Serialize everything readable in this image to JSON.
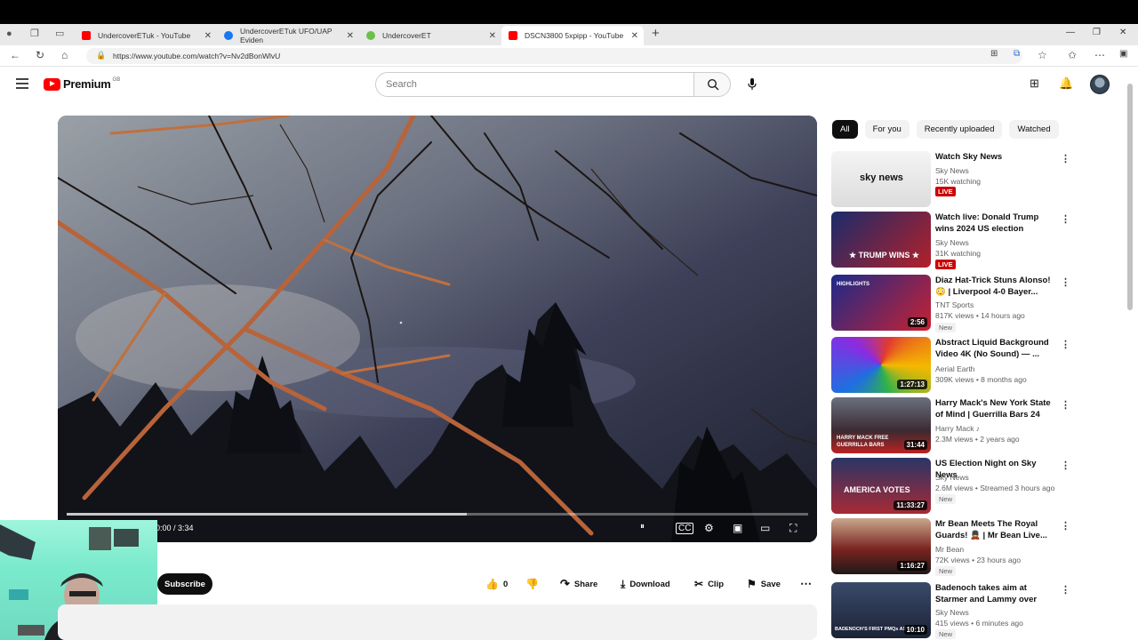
{
  "browser": {
    "tabs": [
      {
        "title": "UndercoverETuk - YouTube",
        "favicon_color": "#ff0000"
      },
      {
        "title": "UndercoverETuk UFO/UAP Eviden",
        "favicon_color": "#1877f2"
      },
      {
        "title": "UndercoverET",
        "favicon_color": "#6cc04a"
      },
      {
        "title": "DSCN3800 5xpipp - YouTube",
        "favicon_color": "#ff0000"
      }
    ],
    "new_tab": "+",
    "url": "https://www.youtube.com/watch?v=Nv2dBonWlvU"
  },
  "youtube": {
    "logo_text": "Premium",
    "logo_region": "GB",
    "search_placeholder": "Search",
    "video": {
      "time": "0:00 / 3:34",
      "progress_fraction": 0.54
    },
    "subscribe_label": "Subscribe",
    "actions": {
      "like_count": "0",
      "share": "Share",
      "download": "Download",
      "clip": "Clip",
      "save": "Save"
    },
    "chips": [
      "All",
      "For you",
      "Recently uploaded",
      "Watched"
    ],
    "recommendations": [
      {
        "title": "Watch Sky News",
        "channel": "Sky News",
        "meta": "15K watching",
        "badge": "LIVE",
        "duration": "",
        "thumb_text": "sky news"
      },
      {
        "title": "Watch live: Donald Trump wins 2024 US election",
        "channel": "Sky News",
        "meta": "31K watching",
        "badge": "LIVE",
        "duration": "",
        "thumb_text": "★ TRUMP WINS ★"
      },
      {
        "title": "Diaz Hat-Trick Stuns Alonso! 😳 | Liverpool 4-0 Bayer...",
        "channel": "TNT Sports",
        "meta": "817K views • 14 hours ago",
        "badge": "New",
        "duration": "2:56",
        "thumb_text": "HIGHLIGHTS"
      },
      {
        "title": "Abstract Liquid Background Video 4K (No Sound) — ...",
        "channel": "Aerial Earth",
        "meta": "309K views • 8 months ago",
        "badge": "",
        "duration": "1:27:13",
        "thumb_text": ""
      },
      {
        "title": "Harry Mack's New York State of Mind | Guerrilla Bars 24",
        "channel": "Harry Mack ♪",
        "meta": "2.3M views • 2 years ago",
        "badge": "",
        "duration": "31:44",
        "thumb_text": "HARRY MACK FREE GUERRILLA BARS"
      },
      {
        "title": "US Election Night on Sky News",
        "channel": "Sky News",
        "meta": "2.6M views • Streamed 3 hours ago",
        "badge": "New",
        "duration": "11:33:27",
        "thumb_text": "AMERICA VOTES"
      },
      {
        "title": "Mr Bean Meets The Royal Guards! 💂 | Mr Bean Live...",
        "channel": "Mr Bean",
        "meta": "72K views • 23 hours ago",
        "badge": "New",
        "duration": "1:16:27",
        "thumb_text": ""
      },
      {
        "title": "Badenoch takes aim at Starmer and Lammy over Trump...",
        "channel": "Sky News",
        "meta": "415 views • 6 minutes ago",
        "badge": "New",
        "duration": "10:10",
        "thumb_text": "BADENOCH'S FIRST PMQs AS LE"
      }
    ]
  }
}
